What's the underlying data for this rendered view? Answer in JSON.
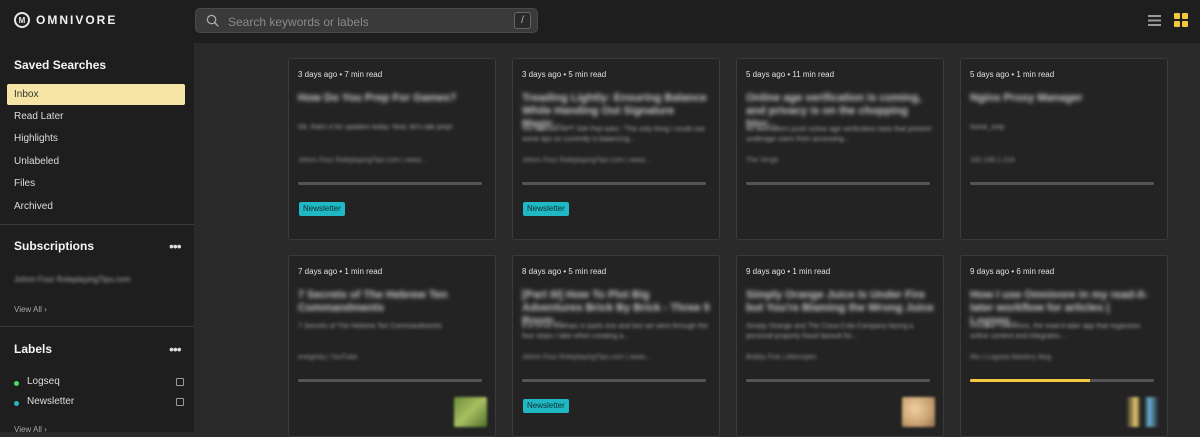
{
  "app": {
    "logo_text": "OMNIVORE"
  },
  "search": {
    "placeholder": "Search keywords or labels",
    "shortcut": "/"
  },
  "sidebar": {
    "saved_title": "Saved Searches",
    "saved_items": [
      {
        "label": "Inbox"
      },
      {
        "label": "Read Later"
      },
      {
        "label": "Highlights"
      },
      {
        "label": "Unlabeled"
      },
      {
        "label": "Files"
      },
      {
        "label": "Archived"
      }
    ],
    "subscriptions_title": "Subscriptions",
    "subscriptions_more": "•••",
    "subscription_item": "Johnn Four RoleplayingTips.com",
    "subscriptions_view_all": "View All ›",
    "labels_title": "Labels",
    "labels_more": "•••",
    "labels": [
      {
        "name": "Logseq",
        "color": "#4cd964"
      },
      {
        "name": "Newsletter",
        "color": "#1fb8c4"
      }
    ],
    "labels_view_all": "View All ›"
  },
  "cards": [
    {
      "meta": "3 days ago • 7 min read",
      "title": "How Do You Prep For Games?",
      "desc": "Ok, that's it for updates today. Now, let's talk prep!",
      "author": "Johnn Four RoleplayingTips.com | www...",
      "progress": 0,
      "tag": "Newsletter",
      "thumb": null
    },
    {
      "meta": "3 days ago • 5 min read",
      "title": "Treading Lightly: Ensuring Balance While Handing Out Signature Magic...",
      "desc": "Stu Mathios RPT GM Pad asks: \"The only thing I could use some tips on currently is balancing...",
      "author": "Johnn Four RoleplayingTips.com | www...",
      "progress": 0,
      "tag": "Newsletter",
      "thumb": null
    },
    {
      "meta": "5 days ago • 11 min read",
      "title": "Online age verification is coming, and privacy is on the chopping bloc...",
      "desc": "As lawmakers push online age verification laws that prevent underage users from accessing...",
      "author": "The Verge",
      "progress": 0,
      "tag": null,
      "thumb": null
    },
    {
      "meta": "5 days ago • 1 min read",
      "title": "Nginx Proxy Manager",
      "desc": "home_only",
      "author": "192.168.1.224",
      "progress": 0,
      "tag": null,
      "thumb": null
    },
    {
      "meta": "7 days ago • 1 min read",
      "title": "7 Secrets of The Hebrew Ten Commandments",
      "desc": "7 Secrets of The Hebrew Ten Commandments",
      "author": "exegetiq | YouTube",
      "progress": 0,
      "tag": null,
      "thumb": "green"
    },
    {
      "meta": "8 days ago • 5 min read",
      "title": "[Part III] How To Plot Big Adventures Brick By Brick - Three 5 Room...",
      "desc": "Era Druid Mathias in parts one and two we went through the four steps I take when creating a...",
      "author": "Johnn Four RoleplayingTips.com | www...",
      "progress": 0,
      "tag": "Newsletter",
      "thumb": null
    },
    {
      "meta": "9 days ago • 1 min read",
      "title": "Simply Orange Juice Is Under Fire but You're Blaming the Wrong Juice",
      "desc": "Simply Orange and The Coca-Cola Company facing a personal property fraud lawsuit for...",
      "author": "Bobby Fick | Allrecipes",
      "progress": 0,
      "tag": null,
      "thumb": "orange"
    },
    {
      "meta": "9 days ago • 6 min read",
      "title": "How I use Omnivore in my read-it-later workflow for articles | Logseq...",
      "desc": "Discover Omnivore, the read-it-later app that organizes online content and integrates...",
      "author": "Wu | Logseq Mastery blog",
      "progress": 65,
      "tag": null,
      "thumb": "hourglass"
    }
  ]
}
